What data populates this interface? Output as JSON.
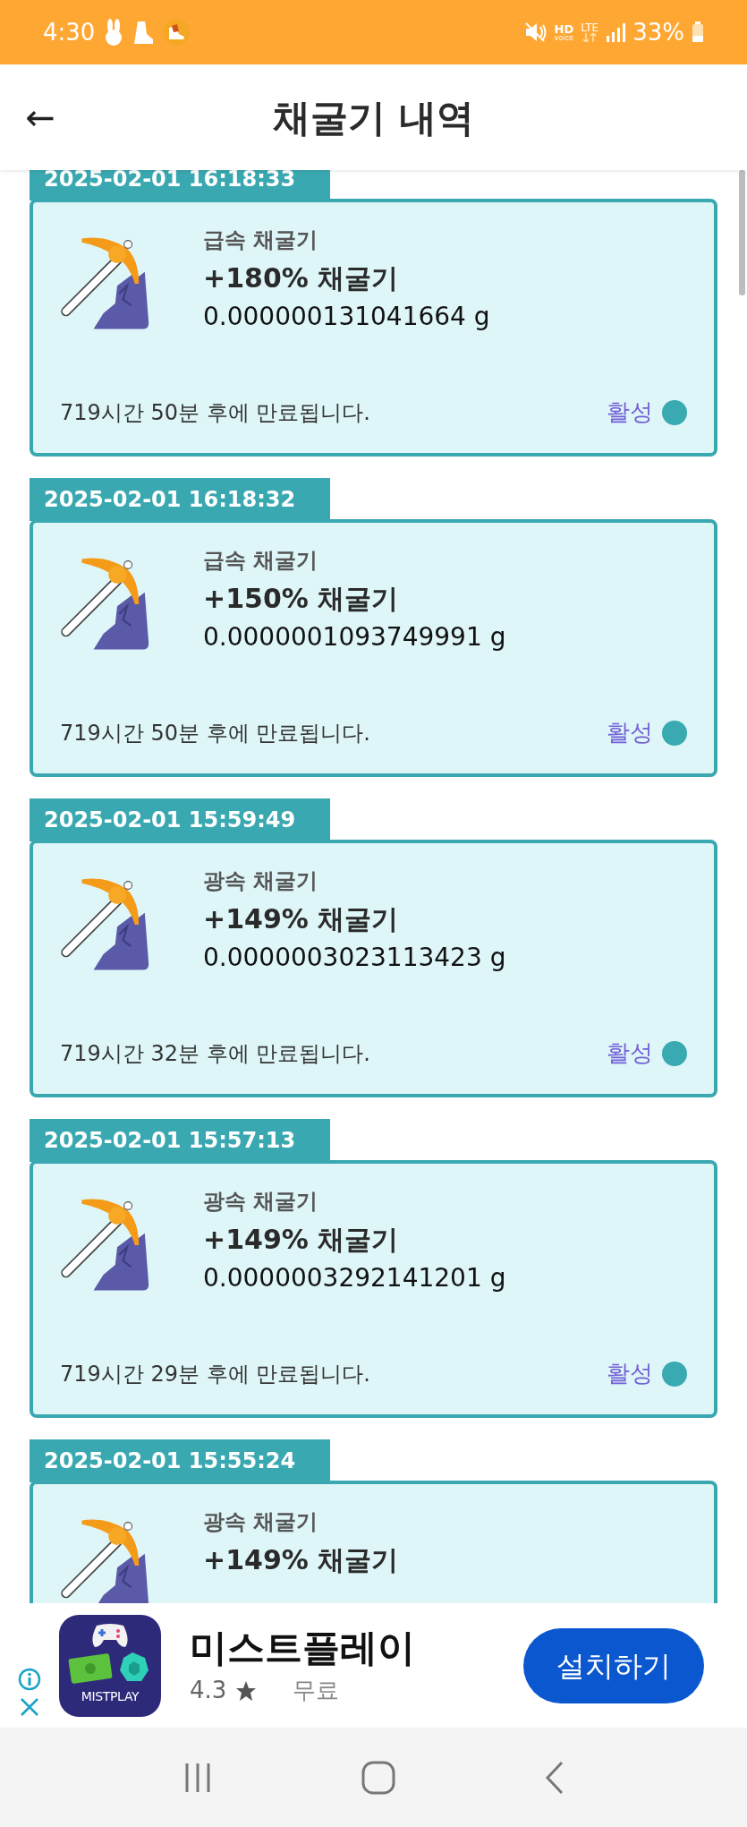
{
  "status_bar": {
    "time": "4:30",
    "network_hd": "HD",
    "network_voice": "voice",
    "network_type": "LTE",
    "battery": "33%"
  },
  "header": {
    "back": "←",
    "title": "채굴기 내역"
  },
  "miners": [
    {
      "timestamp": "2025-02-01 16:18:33",
      "type": "급속 채굴기",
      "title": "+180% 채굴기",
      "amount": "0.000000131041664 g",
      "expiry": "719시간 50분 후에 만료됩니다.",
      "status": "활성",
      "active": true
    },
    {
      "timestamp": "2025-02-01 16:18:32",
      "type": "급속 채굴기",
      "title": "+150% 채굴기",
      "amount": "0.0000001093749991 g",
      "expiry": "719시간 50분 후에 만료됩니다.",
      "status": "활성",
      "active": true
    },
    {
      "timestamp": "2025-02-01 15:59:49",
      "type": "광속 채굴기",
      "title": "+149% 채굴기",
      "amount": "0.0000003023113423 g",
      "expiry": "719시간 32분 후에 만료됩니다.",
      "status": "활성",
      "active": true
    },
    {
      "timestamp": "2025-02-01 15:57:13",
      "type": "광속 채굴기",
      "title": "+149% 채굴기",
      "amount": "0.0000003292141201 g",
      "expiry": "719시간 29분 후에 만료됩니다.",
      "status": "활성",
      "active": true
    },
    {
      "timestamp": "2025-02-01 15:55:24",
      "type": "광속 채굴기",
      "title": "+149% 채굴기"
    }
  ],
  "ad": {
    "app_icon_label": "MISTPLAY",
    "app_name": "미스트플레이",
    "rating": "4.3",
    "price": "무료",
    "install": "설치하기"
  }
}
